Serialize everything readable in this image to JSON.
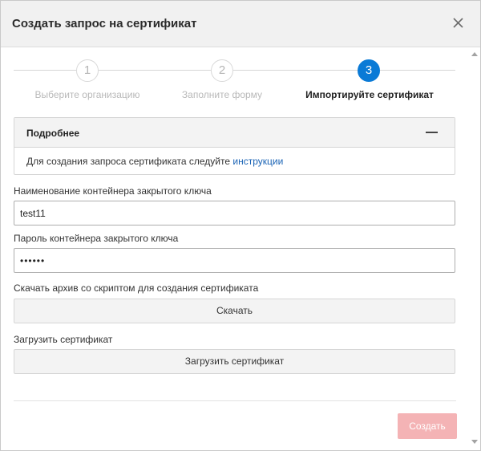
{
  "dialog": {
    "title": "Создать запрос на сертификат",
    "close_icon": "close-icon"
  },
  "stepper": {
    "steps": [
      {
        "number": "1",
        "label": "Выберите организацию",
        "state": "completed"
      },
      {
        "number": "2",
        "label": "Заполните форму",
        "state": "completed"
      },
      {
        "number": "3",
        "label": "Импортируйте сертификат",
        "state": "active"
      }
    ],
    "active_color": "#0a7ad6"
  },
  "details": {
    "title": "Подробнее",
    "collapse_icon": "minus-icon",
    "text": "Для создания запроса сертификата следуйте ",
    "link": "инструкции"
  },
  "form": {
    "container_name": {
      "label": "Наименование контейнера закрытого ключа",
      "value": "test11"
    },
    "container_password": {
      "label": "Пароль контейнера закрытого ключа",
      "value": "••••••"
    },
    "download": {
      "label": "Скачать архив со скриптом для создания сертификата",
      "button": "Скачать"
    },
    "upload": {
      "label": "Загрузить сертификат",
      "button": "Загрузить сертификат"
    }
  },
  "footer": {
    "submit_label": "Создать",
    "submit_color": "#f4b3b5"
  }
}
